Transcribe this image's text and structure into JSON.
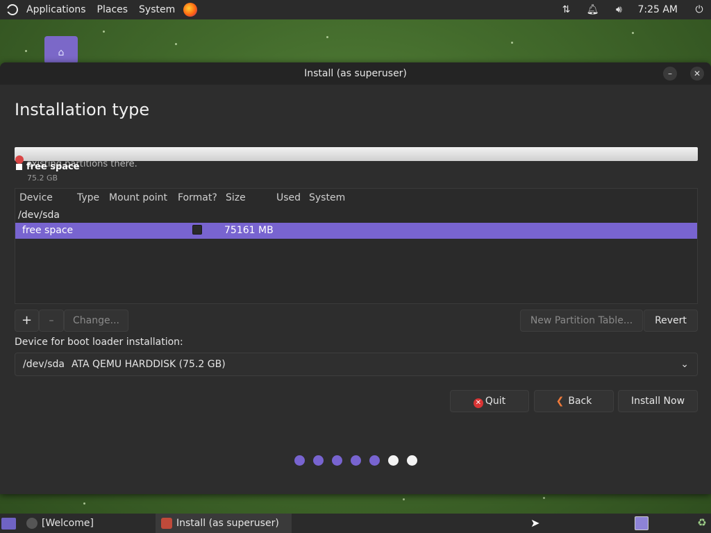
{
  "top_panel": {
    "menus": [
      "Applications",
      "Places",
      "System"
    ],
    "tray_icons": [
      "network-icon",
      "notification-bell-icon",
      "volume-icon",
      "power-icon"
    ],
    "clock": "7:25 AM"
  },
  "window": {
    "title": "Install (as superuser)",
    "minimize_glyph": "–",
    "close_glyph": "✕"
  },
  "page": {
    "title": "Installation type",
    "overlap_notice": "existing partitions there.",
    "legend": {
      "label": "free space",
      "size": "75.2 GB",
      "color": "#ffffff"
    }
  },
  "partition_table": {
    "columns": [
      "Device",
      "Type",
      "Mount point",
      "Format?",
      "Size",
      "Used",
      "System"
    ],
    "disk_row": {
      "device": "/dev/sda"
    },
    "selected_row": {
      "device": "free space",
      "size": "75161 MB"
    }
  },
  "partition_buttons": {
    "add": "+",
    "remove": "–",
    "change": "Change...",
    "new_table": "New Partition Table...",
    "revert": "Revert"
  },
  "boot_loader": {
    "label": "Device for boot loader installation:",
    "device": "/dev/sda",
    "description": "ATA QEMU HARDDISK (75.2 GB)"
  },
  "nav_buttons": {
    "quit": "Quit",
    "back": "Back",
    "install": "Install Now"
  },
  "progress": {
    "completed_steps": 5,
    "total_steps": 7,
    "done_color": "#7864d0",
    "todo_color": "#f4f4f4"
  },
  "taskbar": {
    "tasks": [
      "[Welcome]",
      "Install (as superuser)"
    ]
  },
  "colors": {
    "accent": "#7864d0",
    "window_bg": "#2d2d2d",
    "panel_bg": "#2b2b2b"
  }
}
